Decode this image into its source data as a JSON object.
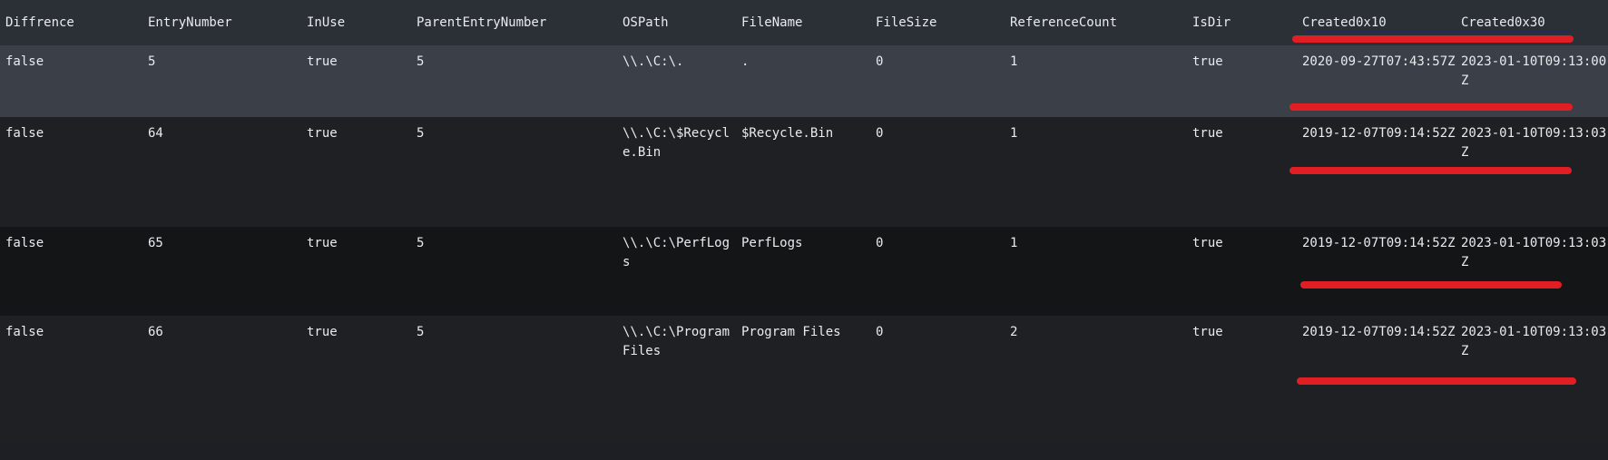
{
  "table": {
    "columns": [
      "Diffrence",
      "EntryNumber",
      "InUse",
      "ParentEntryNumber",
      "OSPath",
      "FileName",
      "FileSize",
      "ReferenceCount",
      "IsDir",
      "Created0x10",
      "Created0x30"
    ],
    "rows": [
      [
        "false",
        "5",
        "true",
        "5",
        "\\\\.\\C:\\.",
        ".",
        "0",
        "1",
        "true",
        "2020-09-27T07:43:57Z",
        "2023-01-10T09:13:00Z"
      ],
      [
        "false",
        "64",
        "true",
        "5",
        "\\\\.\\C:\\$Recycle.Bin",
        "$Recycle.Bin",
        "0",
        "1",
        "true",
        "2019-12-07T09:14:52Z",
        "2023-01-10T09:13:03Z"
      ],
      [
        "false",
        "65",
        "true",
        "5",
        "\\\\.\\C:\\PerfLogs",
        "PerfLogs",
        "0",
        "1",
        "true",
        "2019-12-07T09:14:52Z",
        "2023-01-10T09:13:03Z"
      ],
      [
        "false",
        "66",
        "true",
        "5",
        "\\\\.\\C:\\Program Files",
        "Program Files",
        "0",
        "2",
        "true",
        "2019-12-07T09:14:52Z",
        "2023-01-10T09:13:03Z"
      ]
    ]
  },
  "colors": {
    "header_bg": "#2b2f36",
    "highlight_row": "#3a3f48",
    "annotation_red": "#e01e24"
  }
}
